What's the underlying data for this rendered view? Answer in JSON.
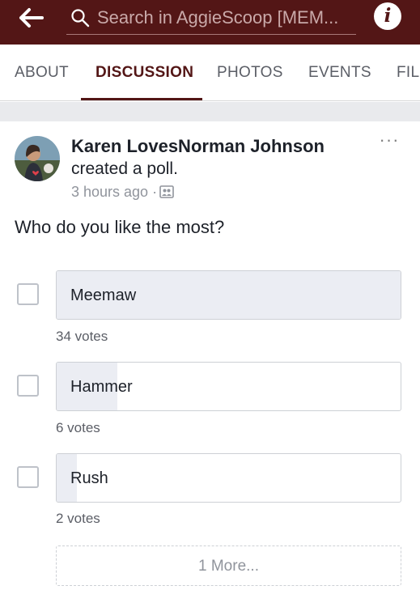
{
  "search": {
    "text": "Search in AggieScoop [MEM..."
  },
  "tabs": [
    {
      "label": "ABOUT"
    },
    {
      "label": "DISCUSSION"
    },
    {
      "label": "PHOTOS"
    },
    {
      "label": "EVENTS"
    },
    {
      "label": "FIL"
    }
  ],
  "active_tab": "DISCUSSION",
  "post": {
    "author": "Karen LovesNorman Johnson",
    "action": "created a poll.",
    "time": "3 hours ago",
    "separator": "·",
    "audience_icon": "group-icon",
    "question": "Who do you like the most?",
    "options": [
      {
        "label": "Meemaw",
        "votes_text": "34 votes",
        "votes": 34
      },
      {
        "label": "Hammer",
        "votes_text": "6 votes",
        "votes": 6
      },
      {
        "label": "Rush",
        "votes_text": "2 votes",
        "votes": 2
      }
    ],
    "more_label": "1 More..."
  },
  "colors": {
    "brand": "#531616",
    "poll_fill": "#ebedf3",
    "gap_background": "#e9eaed"
  }
}
